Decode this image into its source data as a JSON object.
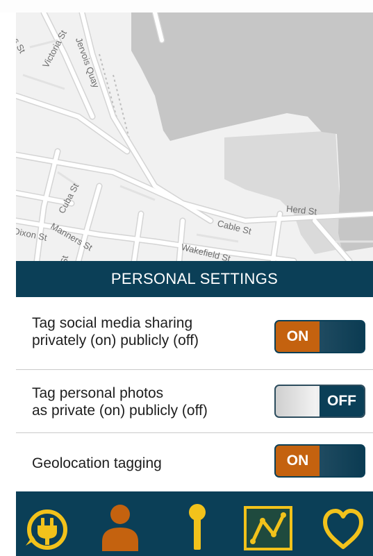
{
  "map": {
    "streets": [
      "Victoria St",
      "Jervois Quay",
      "Cuba St",
      "Manners St",
      "Cable St",
      "Wakefield St",
      "Herd St",
      "Dixon St",
      "ns St",
      "St",
      "nt St"
    ]
  },
  "settings": {
    "title": "PERSONAL SETTINGS",
    "rows": [
      {
        "line1": "Tag social media sharing",
        "line2": "privately (on) publicly (off)",
        "state": "ON"
      },
      {
        "line1": "Tag personal photos",
        "line2": "as private (on) publicly (off)",
        "state": "OFF"
      },
      {
        "line1": "Geolocation tagging",
        "line2": "",
        "state": "ON"
      }
    ]
  },
  "tabbar": {
    "icons": [
      "power-plug-icon",
      "person-icon",
      "pin-icon",
      "chart-icon",
      "heart-icon"
    ],
    "accent": "#f2c21b",
    "active_accent": "#c4620f",
    "background": "#0b3f57"
  },
  "colors": {
    "header_bg": "#0b3f57",
    "on_orange": "#c4620f",
    "map_bg": "#f1f1f1",
    "water": "#c6c6c6"
  }
}
